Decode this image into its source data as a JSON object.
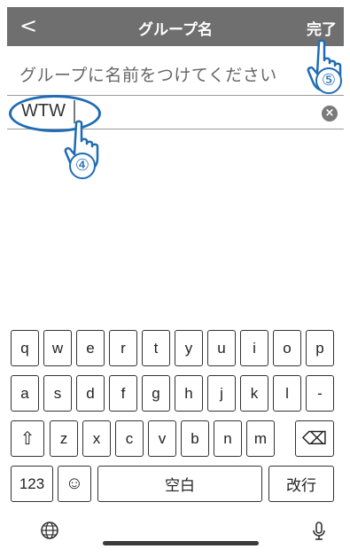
{
  "header": {
    "back_label": "<",
    "title": "グループ名",
    "done_label": "完了"
  },
  "instruction": "グループに名前をつけてください",
  "input": {
    "value": "WTW",
    "clear_label": "×"
  },
  "keyboard": {
    "row1": [
      "q",
      "w",
      "e",
      "r",
      "t",
      "y",
      "u",
      "i",
      "o",
      "p"
    ],
    "row2": [
      "a",
      "s",
      "d",
      "f",
      "g",
      "h",
      "j",
      "k",
      "l",
      "-"
    ],
    "row3": [
      "⇧",
      "z",
      "x",
      "c",
      "v",
      "b",
      "n",
      "m",
      "⌫"
    ],
    "row4": {
      "numbers": "123",
      "emoji": "☺",
      "space": "空白",
      "return": "改行"
    }
  },
  "annotations": {
    "step4": "④",
    "step5": "⑤"
  },
  "colors": {
    "header_bg": "#6f6f6f",
    "accent": "#1f6cb5"
  },
  "icons": [
    "back-chevron-icon",
    "clear-icon",
    "globe-icon",
    "mic-icon",
    "hand-pointer-icon"
  ]
}
